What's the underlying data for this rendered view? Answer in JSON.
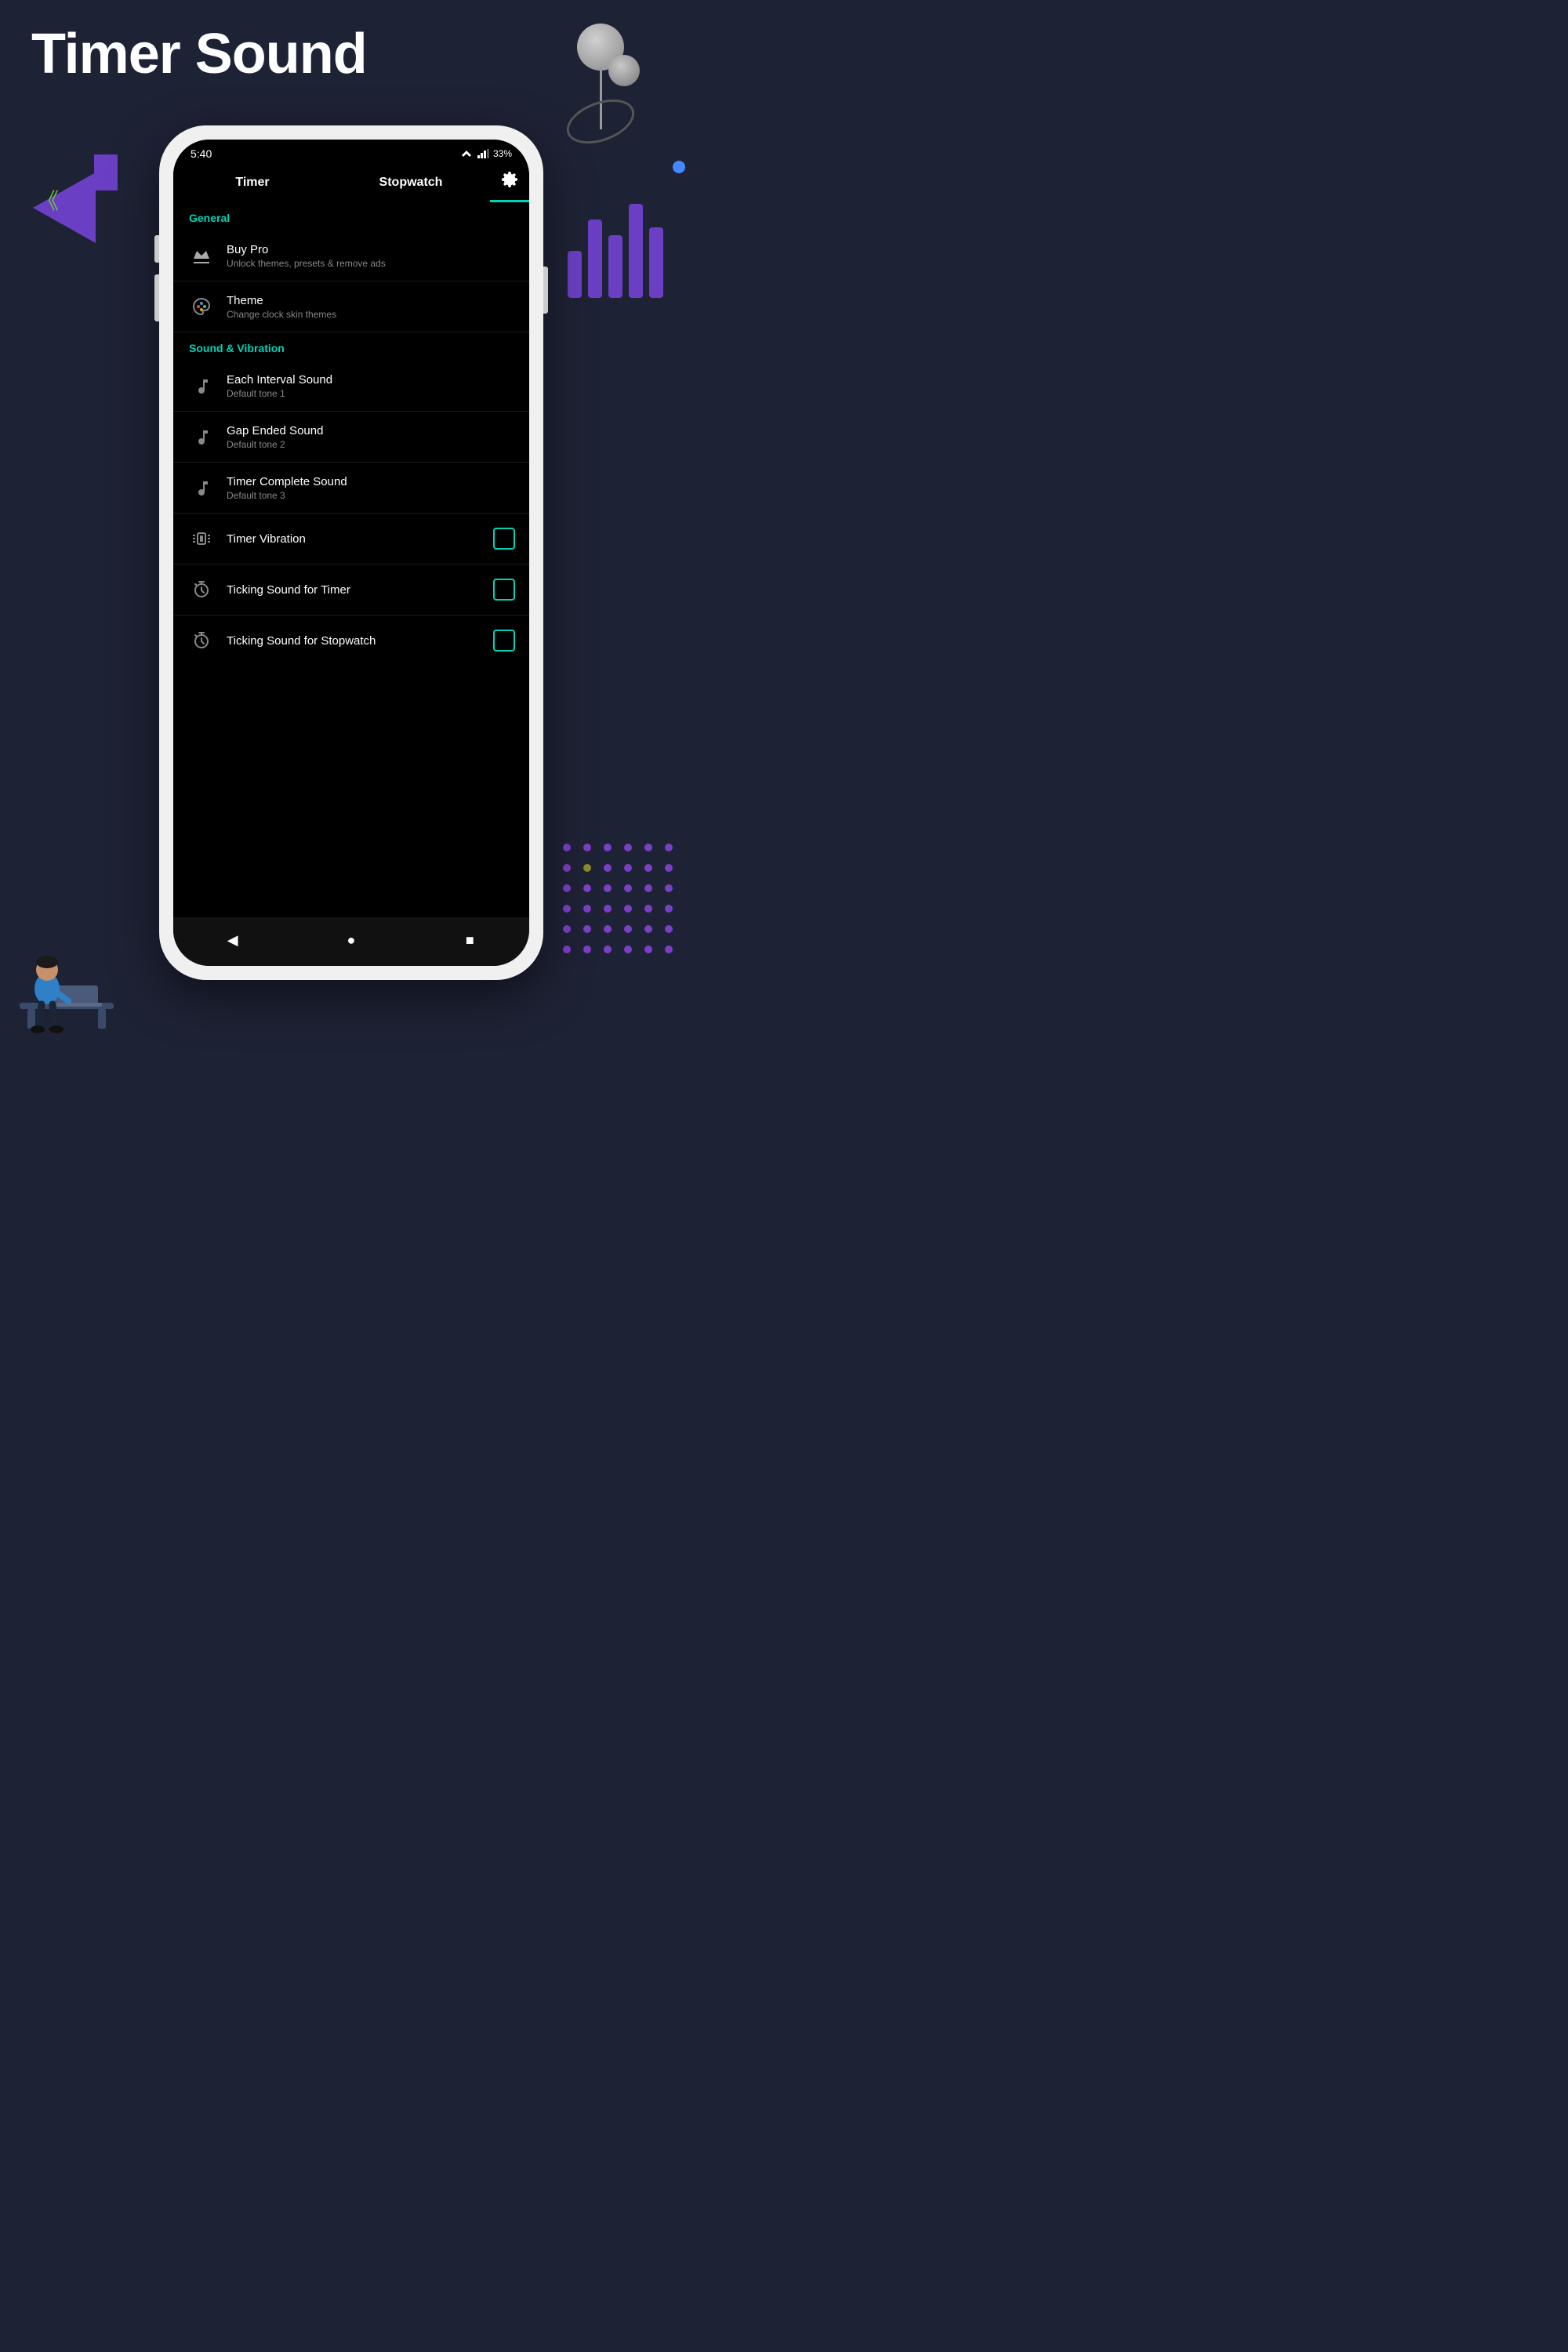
{
  "page": {
    "title": "Timer Sound",
    "background_color": "#1e2235"
  },
  "status_bar": {
    "time": "5:40",
    "battery": "33%",
    "signal_icons": "▼◥▌"
  },
  "nav": {
    "tab_timer": "Timer",
    "tab_stopwatch": "Stopwatch",
    "active_tab": "settings"
  },
  "sections": [
    {
      "id": "general",
      "label": "General",
      "items": [
        {
          "id": "buy-pro",
          "title": "Buy Pro",
          "subtitle": "Unlock themes, presets & remove ads",
          "icon": "crown",
          "has_toggle": false
        },
        {
          "id": "theme",
          "title": "Theme",
          "subtitle": "Change clock skin themes",
          "icon": "palette",
          "has_toggle": false
        }
      ]
    },
    {
      "id": "sound-vibration",
      "label": "Sound & Vibration",
      "items": [
        {
          "id": "each-interval-sound",
          "title": "Each Interval Sound",
          "subtitle": "Default tone 1",
          "icon": "note",
          "has_toggle": false
        },
        {
          "id": "gap-ended-sound",
          "title": "Gap Ended Sound",
          "subtitle": "Default tone 2",
          "icon": "note",
          "has_toggle": false
        },
        {
          "id": "timer-complete-sound",
          "title": "Timer Complete Sound",
          "subtitle": "Default tone 3",
          "icon": "note",
          "has_toggle": false
        },
        {
          "id": "timer-vibration",
          "title": "Timer Vibration",
          "subtitle": "",
          "icon": "vibrate",
          "has_toggle": true,
          "toggle_checked": false
        },
        {
          "id": "ticking-sound-timer",
          "title": "Ticking Sound for Timer",
          "subtitle": "",
          "icon": "timer-clock",
          "has_toggle": true,
          "toggle_checked": false
        },
        {
          "id": "ticking-sound-stopwatch",
          "title": "Ticking Sound for Stopwatch",
          "subtitle": "",
          "icon": "timer-clock",
          "has_toggle": true,
          "toggle_checked": false
        }
      ]
    }
  ],
  "bottom_nav": {
    "back_label": "◀",
    "home_label": "●",
    "recent_label": "■"
  },
  "decorations": {
    "sound_bars": [
      60,
      100,
      80,
      120,
      90
    ],
    "dots_colors": [
      "purple",
      "purple",
      "purple",
      "purple",
      "purple",
      "purple",
      "purple",
      "olive",
      "purple",
      "purple",
      "purple",
      "purple",
      "purple",
      "purple",
      "purple",
      "purple",
      "purple",
      "purple",
      "purple",
      "purple",
      "purple",
      "purple",
      "purple",
      "purple",
      "purple",
      "purple",
      "purple",
      "purple",
      "purple",
      "purple",
      "purple",
      "purple",
      "purple",
      "purple",
      "purple",
      "purple"
    ]
  }
}
